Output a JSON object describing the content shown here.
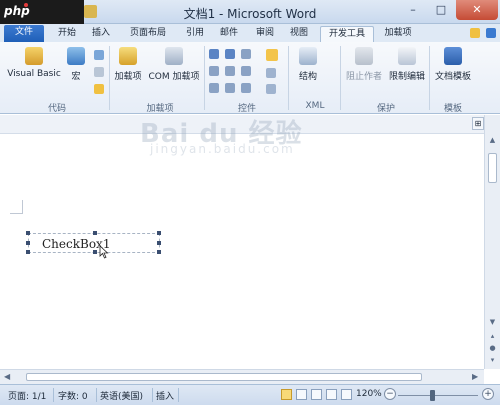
{
  "window": {
    "title": "文档1 - Microsoft Word",
    "minimize": "–",
    "maximize": "□",
    "close": "✕"
  },
  "overlay": {
    "php_badge": "php"
  },
  "tabs": [
    {
      "label": "文件",
      "active": false
    },
    {
      "label": "开始",
      "active": false
    },
    {
      "label": "插入",
      "active": false
    },
    {
      "label": "页面布局",
      "active": false
    },
    {
      "label": "引用",
      "active": false
    },
    {
      "label": "邮件",
      "active": false
    },
    {
      "label": "审阅",
      "active": false
    },
    {
      "label": "视图",
      "active": false
    },
    {
      "label": "开发工具",
      "active": true
    },
    {
      "label": "加载项",
      "active": false
    }
  ],
  "ribbon": {
    "code": {
      "label": "代码",
      "visual_basic": "Visual Basic",
      "macro": "宏"
    },
    "addins": {
      "label": "加载项",
      "addins_btn": "加载项",
      "com_addins": "COM 加载项"
    },
    "controls": {
      "label": "控件"
    },
    "xml": {
      "label": "XML",
      "structure": "结构"
    },
    "protect": {
      "label": "保护",
      "block_authors": "阻止作者",
      "restrict_editing": "限制编辑"
    },
    "templates": {
      "label": "模板",
      "doc_template": "文档模板"
    }
  },
  "document": {
    "checkbox_label": "CheckBox1",
    "watermark": "Bai du 经验",
    "watermark_sub": "jingyan.baidu.com"
  },
  "statusbar": {
    "page": "页面: 1/1",
    "words": "字数: 0",
    "language": "英语(美国)",
    "mode": "插入",
    "zoom": "120%"
  },
  "colors": {
    "file_tab": "#1f5fb8",
    "ribbon_bg": "#e6edf7",
    "active_view": "#f8d977"
  }
}
